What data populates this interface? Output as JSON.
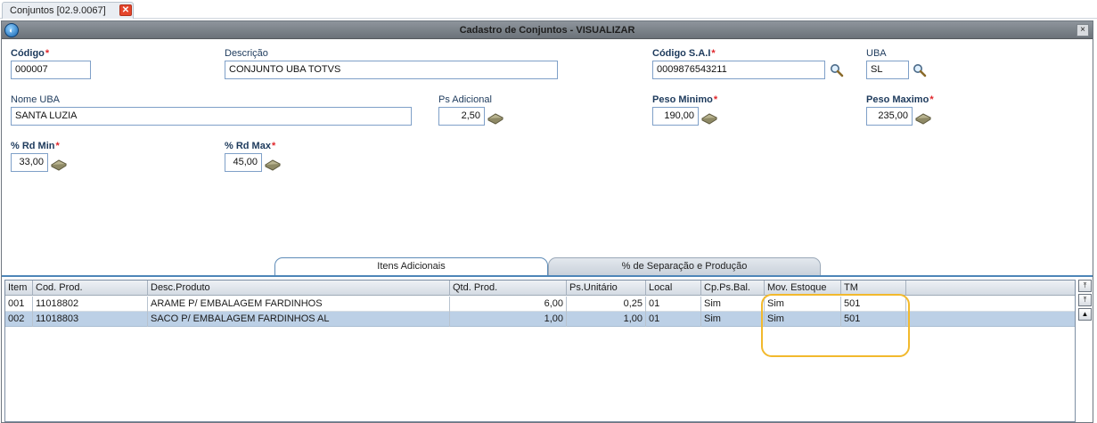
{
  "doc_tab": {
    "label": "Conjuntos [02.9.0067]",
    "close_icon": "close-icon"
  },
  "window": {
    "title": "Cadastro de Conjuntos - VISUALIZAR",
    "close_label": "×"
  },
  "form": {
    "codigo": {
      "label": "Código",
      "value": "000007"
    },
    "descricao": {
      "label": "Descrição",
      "value": "CONJUNTO UBA TOTVS"
    },
    "codigo_sai": {
      "label": "Código S.A.I",
      "value": "0009876543211"
    },
    "uba": {
      "label": "UBA",
      "value": "SL"
    },
    "nome_uba": {
      "label": "Nome UBA",
      "value": "SANTA LUZIA"
    },
    "ps_adicional": {
      "label": "Ps Adicional",
      "value": "2,50"
    },
    "peso_minimo": {
      "label": "Peso Minimo",
      "value": "190,00"
    },
    "peso_maximo": {
      "label": "Peso Maximo",
      "value": "235,00"
    },
    "rd_min": {
      "label": "% Rd Min",
      "value": "33,00"
    },
    "rd_max": {
      "label": "% Rd Max",
      "value": "45,00"
    },
    "required_mark": "*"
  },
  "tabs": [
    {
      "label": "Itens Adicionais",
      "active": true
    },
    {
      "label": "% de Separação e Produção",
      "active": false
    }
  ],
  "grid": {
    "columns": [
      "Item",
      "Cod. Prod.",
      "Desc.Produto",
      "Qtd. Prod.",
      "Ps.Unitário",
      "Local",
      "Cp.Ps.Bal.",
      "Mov. Estoque",
      "TM"
    ],
    "rows": [
      [
        "001",
        "11018802",
        "ARAME P/ EMBALAGEM FARDINHOS",
        "6,00",
        "0,25",
        "01",
        "Sim",
        "Sim",
        "501"
      ],
      [
        "002",
        "11018803",
        "SACO P/ EMBALAGEM FARDINHOS AL",
        "1,00",
        "1,00",
        "01",
        "Sim",
        "Sim",
        "501"
      ]
    ],
    "selected_row": 1
  },
  "scroll": {
    "top_label": "⤒",
    "up_label": "▲"
  },
  "colors": {
    "title_bar": "#7b8289",
    "accent_blue": "#4d86b8",
    "highlight": "#f2b92d",
    "required": "#e0262b"
  }
}
